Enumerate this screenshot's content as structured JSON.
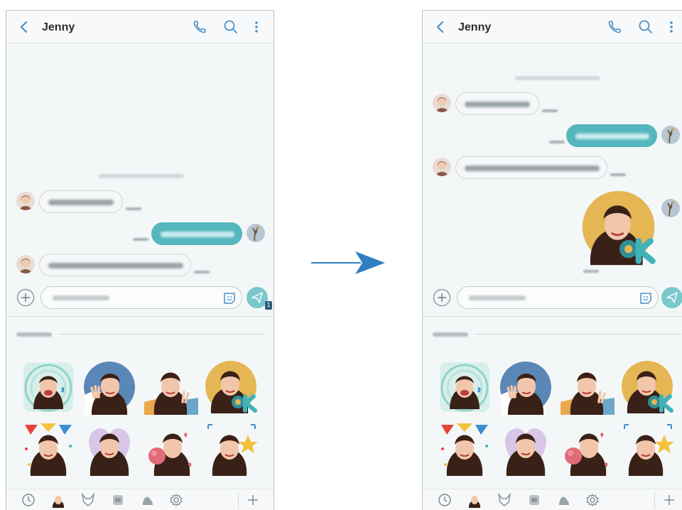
{
  "conversation": {
    "contact_name": "Jenny"
  },
  "colors": {
    "accent_teal": "#55b7bd",
    "arrow_blue": "#2f7fc1",
    "background_panel": "#f4f7f8"
  },
  "icons": {
    "back": "chevron-left-icon",
    "call": "phone-icon",
    "search": "search-icon",
    "more": "more-vertical-icon",
    "attach": "plus-circle-icon",
    "emoji": "smiley-icon",
    "send": "send-icon",
    "recent": "clock-icon",
    "settings": "gear-icon",
    "add": "plus-icon"
  },
  "screens": [
    {
      "id": "before",
      "title": "Jenny"
    },
    {
      "id": "after",
      "title": "Jenny"
    }
  ],
  "send_badge": "1"
}
